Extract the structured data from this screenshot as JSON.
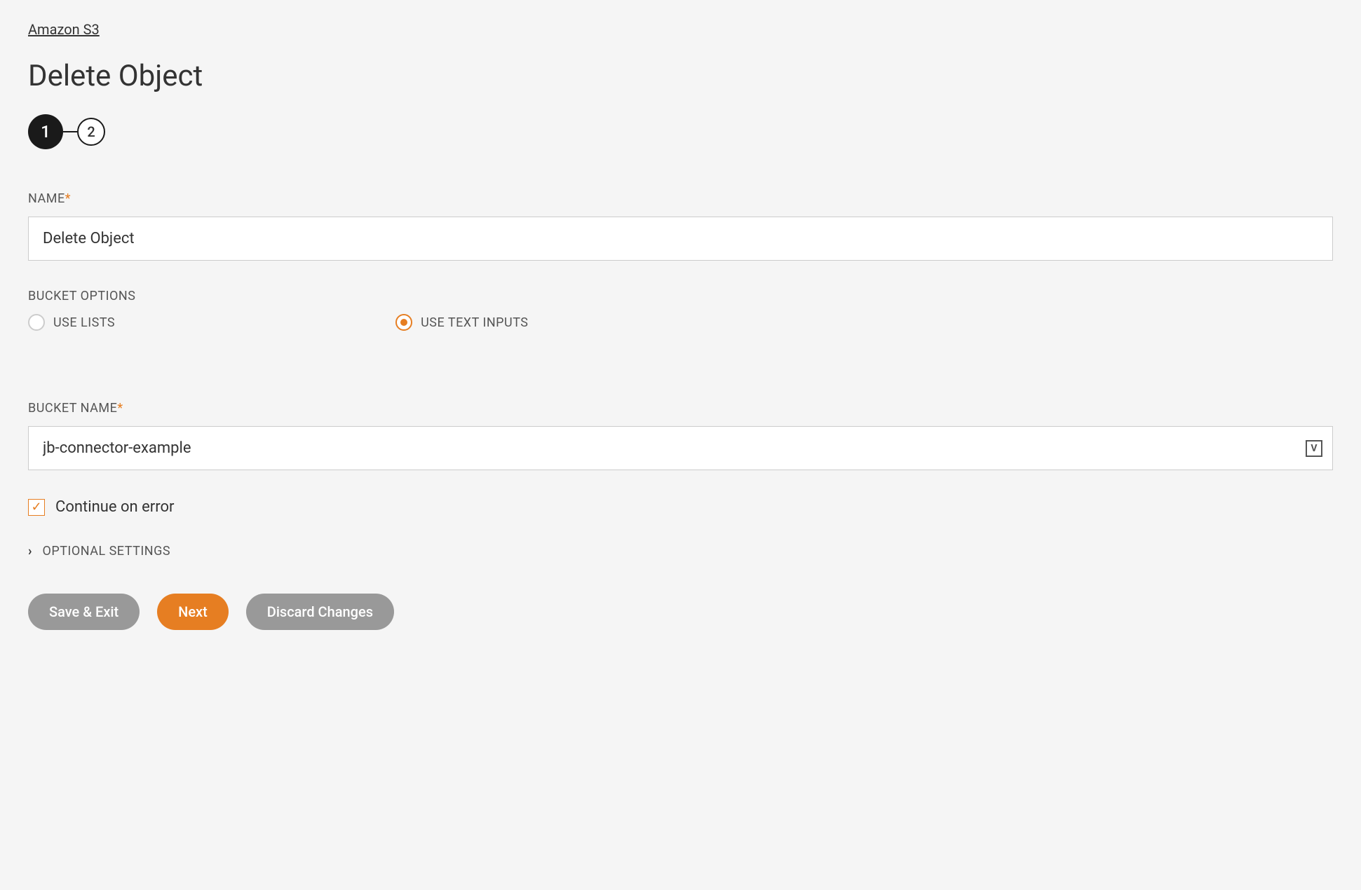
{
  "breadcrumb": {
    "label": "Amazon S3"
  },
  "page": {
    "title": "Delete Object"
  },
  "stepper": {
    "step1": "1",
    "step2": "2"
  },
  "form": {
    "name": {
      "label": "NAME",
      "value": "Delete Object"
    },
    "bucket_options": {
      "label": "BUCKET OPTIONS",
      "use_lists": "USE LISTS",
      "use_text_inputs": "USE TEXT INPUTS"
    },
    "bucket_name": {
      "label": "BUCKET NAME",
      "value": "jb-connector-example"
    },
    "continue_on_error": {
      "label": "Continue on error"
    },
    "optional_settings": {
      "label": "OPTIONAL SETTINGS"
    }
  },
  "buttons": {
    "save_exit": "Save & Exit",
    "next": "Next",
    "discard": "Discard Changes"
  }
}
